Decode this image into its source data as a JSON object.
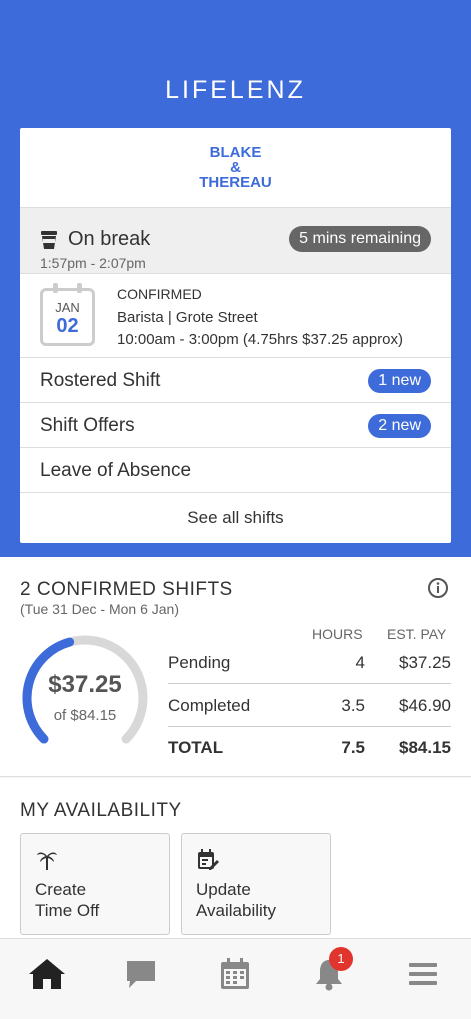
{
  "app": {
    "brand": "LIFELENZ"
  },
  "card": {
    "logo_lines": [
      "BLAKE",
      "&",
      "THEREAU"
    ],
    "break": {
      "title": "On break",
      "time": "1:57pm - 2:07pm",
      "remaining": "5 mins remaining",
      "icon": "coffee-cup-icon"
    },
    "shift": {
      "month": "JAN",
      "day": "02",
      "status": "CONFIRMED",
      "location": "Barista | Grote Street",
      "hours": "10:00am - 3:00pm (4.75hrs $37.25 approx)"
    },
    "rows": [
      {
        "label": "Rostered Shift",
        "badge": "1 new"
      },
      {
        "label": "Shift Offers",
        "badge": "2 new"
      },
      {
        "label": "Leave of Absence",
        "badge": ""
      }
    ],
    "see_all": "See all shifts"
  },
  "summary": {
    "title": "2 CONFIRMED SHIFTS",
    "range": "(Tue 31 Dec - Mon 6 Jan)",
    "amount": "$37.25",
    "of_total": "of $84.15",
    "progress_fraction": 0.443,
    "headers": {
      "hours": "HOURS",
      "pay": "EST. PAY"
    },
    "rows": [
      {
        "label": "Pending",
        "hours": "4",
        "pay": "$37.25"
      },
      {
        "label": "Completed",
        "hours": "3.5",
        "pay": "$46.90"
      },
      {
        "label": "TOTAL",
        "hours": "7.5",
        "pay": "$84.15"
      }
    ]
  },
  "availability": {
    "title": "MY AVAILABILITY",
    "tiles": [
      {
        "line1": "Create",
        "line2": "Time Off",
        "icon": "palm-tree-icon"
      },
      {
        "line1": "Update",
        "line2": "Availability",
        "icon": "edit-calendar-icon"
      }
    ]
  },
  "tabbar": {
    "items": [
      "home-icon",
      "chat-icon",
      "calendar-icon",
      "bell-icon",
      "menu-icon"
    ],
    "notification_count": "1"
  },
  "colors": {
    "primary": "#3d6bd9",
    "badge_red": "#e0342c",
    "badge_gray": "#666666"
  }
}
